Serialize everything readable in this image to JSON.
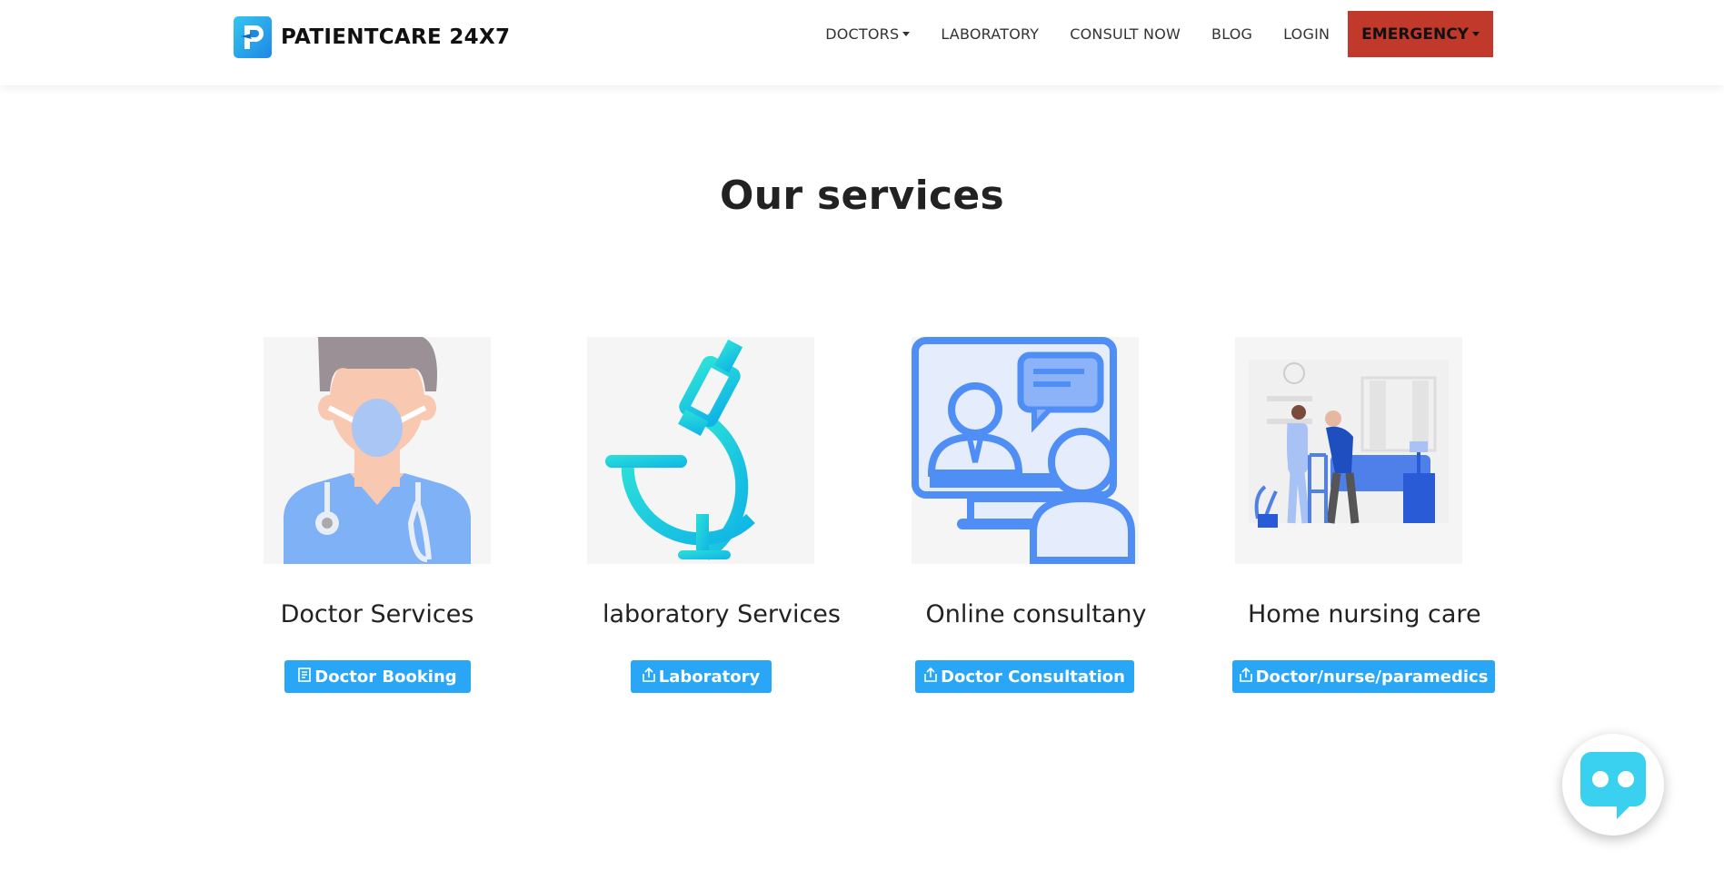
{
  "brand": {
    "name": "PATIENTCARE 24X7"
  },
  "nav": {
    "items": [
      {
        "label": "DOCTORS",
        "dropdown": true
      },
      {
        "label": "LABORATORY",
        "dropdown": false
      },
      {
        "label": "CONSULT NOW",
        "dropdown": false
      },
      {
        "label": "BLOG",
        "dropdown": false
      },
      {
        "label": "LOGIN",
        "dropdown": false
      }
    ],
    "emergency": {
      "label": "EMERGENCY",
      "color": "#c0392b"
    }
  },
  "section": {
    "title": "Our services"
  },
  "services": [
    {
      "title": "Doctor Services",
      "button": "Doctor Booking",
      "icon": "document-icon"
    },
    {
      "title": "laboratory Services",
      "button": "Laboratory",
      "icon": "share-icon"
    },
    {
      "title": "Online consultany",
      "button": "Doctor Consultation",
      "icon": "share-icon"
    },
    {
      "title": "Home nursing care",
      "button": "Doctor/nurse/paramedics",
      "icon": "share-icon"
    }
  ],
  "colors": {
    "accent": "#29a6f5",
    "emergency": "#c0392b"
  },
  "chat": {
    "icon": "chatbot-icon"
  }
}
